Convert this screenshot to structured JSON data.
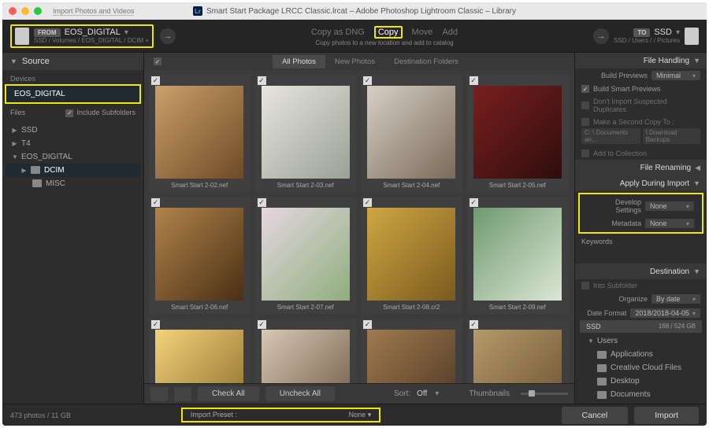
{
  "titlebar": {
    "doc_label": "Smart Start Package LRCC Classic.lrcat – Adobe Photoshop Lightroom Classic – Library",
    "tab_text": "Import Photos and Videos"
  },
  "topbar": {
    "from_label": "FROM",
    "from_device": "EOS_DIGITAL",
    "from_path": "SSD / Volumes / EOS_DIGITAL / DCIM +",
    "mode_copy_dng": "Copy as DNG",
    "mode_copy": "Copy",
    "mode_move": "Move",
    "mode_add": "Add",
    "mode_caption": "Copy photos to a new location and add to catalog",
    "to_label": "TO",
    "to_device": "SSD",
    "to_path": "SSD / Users /",
    "to_folder": "/ Pictures"
  },
  "source": {
    "header": "Source",
    "devices_label": "Devices",
    "device_name": "EOS_DIGITAL",
    "files_label": "Files",
    "include_subfolders": "Include Subfolders",
    "volumes": [
      "SSD",
      "T4",
      "EOS_DIGITAL"
    ],
    "eos_children": [
      "DCIM",
      "MISC"
    ]
  },
  "center": {
    "tabs": [
      "All Photos",
      "New Photos",
      "Destination Folders"
    ],
    "thumbs": [
      {
        "cap": "Smart Start 2-02.nef"
      },
      {
        "cap": "Smart Start 2-03.nef"
      },
      {
        "cap": "Smart Start 2-04.nef"
      },
      {
        "cap": "Smart Start 2-05.nef"
      },
      {
        "cap": "Smart Start 2-06.nef"
      },
      {
        "cap": "Smart Start 2-07.nef"
      },
      {
        "cap": "Smart Start 2-08.cr2"
      },
      {
        "cap": "Smart Start 2-09.nef"
      },
      {
        "cap": ""
      },
      {
        "cap": ""
      },
      {
        "cap": ""
      },
      {
        "cap": ""
      }
    ],
    "check_all": "Check All",
    "uncheck_all": "Uncheck All",
    "sort_label": "Sort:",
    "sort_value": "Off",
    "thumbs_label": "Thumbnails"
  },
  "right": {
    "file_handling": "File Handling",
    "build_previews": "Build Previews",
    "build_previews_val": "Minimal",
    "build_smart": "Build Smart Previews",
    "dont_import": "Don't Import Suspected Duplicates",
    "second_copy": "Make a Second Copy To :",
    "second_copy_paths": [
      "C: \\ Documents an…",
      "\\ Download Backups"
    ],
    "add_collection": "Add to Collection",
    "file_renaming": "File Renaming",
    "apply_import": "Apply During Import",
    "develop_settings": "Develop Settings",
    "develop_val": "None",
    "metadata": "Metadata",
    "metadata_val": "None",
    "keywords": "Keywords",
    "destination": "Destination",
    "into_subfolder": "Into Subfolder",
    "organize": "Organize",
    "organize_val": "By date",
    "date_format": "Date Format",
    "date_format_val": "2018/2018-04-05",
    "dest_drive": "SSD",
    "dest_cap": "168 / 524 GB",
    "dest_tree": [
      "Users",
      "Applications",
      "Creative Cloud Files",
      "Desktop",
      "Documents"
    ]
  },
  "bottom": {
    "summary": "473 photos / 11 GB",
    "preset_label": "Import Preset :",
    "preset_value": "None",
    "cancel": "Cancel",
    "import": "Import"
  }
}
